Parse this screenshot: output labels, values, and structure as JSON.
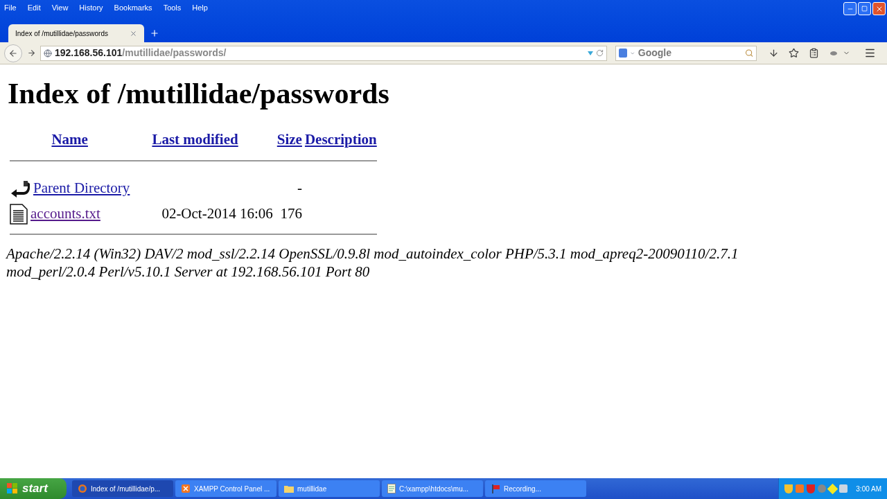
{
  "menu": [
    "File",
    "Edit",
    "View",
    "History",
    "Bookmarks",
    "Tools",
    "Help"
  ],
  "tabs": [
    {
      "title": "Index of /mutillidae/passwords",
      "selected": true
    }
  ],
  "address": {
    "host": "192.168.56.101",
    "path": "/mutillidae/passwords/"
  },
  "search": {
    "placeholder": "Google"
  },
  "page": {
    "heading": "Index of /mutillidae/passwords",
    "columns": [
      "Name",
      "Last modified",
      "Size",
      "Description"
    ],
    "rows": [
      {
        "kind": "parent",
        "name": "Parent Directory",
        "visited": false,
        "modified": "",
        "size": "-"
      },
      {
        "kind": "file",
        "name": "accounts.txt",
        "visited": true,
        "modified": "02-Oct-2014 16:06",
        "size": "176"
      }
    ],
    "address_line": "Apache/2.2.14 (Win32) DAV/2 mod_ssl/2.2.14 OpenSSL/0.9.8l mod_autoindex_color PHP/5.3.1 mod_apreq2-20090110/2.7.1 mod_perl/2.0.4 Perl/v5.10.1 Server at 192.168.56.101 Port 80"
  },
  "taskbar": {
    "start": "start",
    "tasks": [
      {
        "kind": "browser",
        "label": "Index of /mutillidae/p...",
        "selected": true
      },
      {
        "kind": "xampp",
        "label": "XAMPP Control Panel ...",
        "selected": false
      },
      {
        "kind": "folder",
        "label": "mutillidae",
        "selected": false
      },
      {
        "kind": "notepad",
        "label": "C:\\xampp\\htdocs\\mu...",
        "selected": false
      },
      {
        "kind": "recorder",
        "label": "Recording...",
        "selected": false
      }
    ],
    "clock": "3:00 AM"
  }
}
